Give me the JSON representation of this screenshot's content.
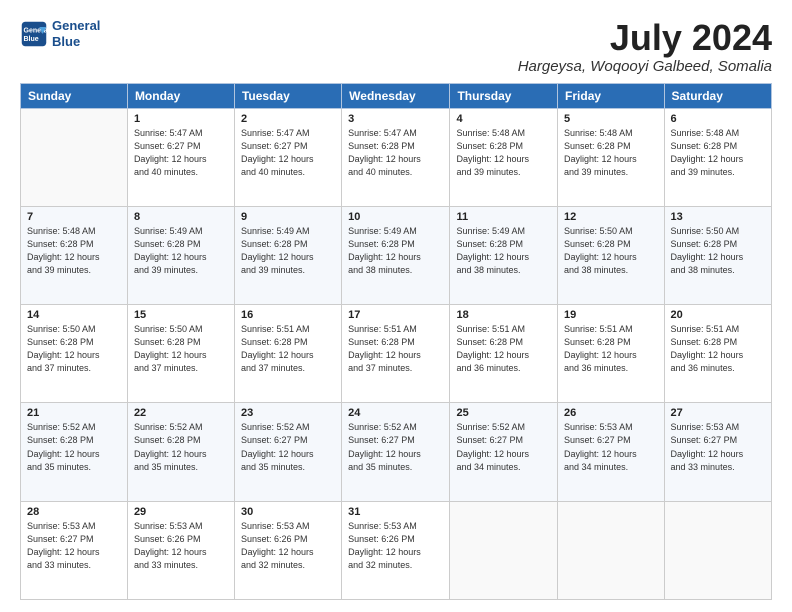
{
  "logo": {
    "line1": "General",
    "line2": "Blue"
  },
  "title": "July 2024",
  "subtitle": "Hargeysa, Woqooyi Galbeed, Somalia",
  "weekdays": [
    "Sunday",
    "Monday",
    "Tuesday",
    "Wednesday",
    "Thursday",
    "Friday",
    "Saturday"
  ],
  "weeks": [
    [
      {
        "day": "",
        "info": ""
      },
      {
        "day": "1",
        "info": "Sunrise: 5:47 AM\nSunset: 6:27 PM\nDaylight: 12 hours\nand 40 minutes."
      },
      {
        "day": "2",
        "info": "Sunrise: 5:47 AM\nSunset: 6:27 PM\nDaylight: 12 hours\nand 40 minutes."
      },
      {
        "day": "3",
        "info": "Sunrise: 5:47 AM\nSunset: 6:28 PM\nDaylight: 12 hours\nand 40 minutes."
      },
      {
        "day": "4",
        "info": "Sunrise: 5:48 AM\nSunset: 6:28 PM\nDaylight: 12 hours\nand 39 minutes."
      },
      {
        "day": "5",
        "info": "Sunrise: 5:48 AM\nSunset: 6:28 PM\nDaylight: 12 hours\nand 39 minutes."
      },
      {
        "day": "6",
        "info": "Sunrise: 5:48 AM\nSunset: 6:28 PM\nDaylight: 12 hours\nand 39 minutes."
      }
    ],
    [
      {
        "day": "7",
        "info": "Sunrise: 5:48 AM\nSunset: 6:28 PM\nDaylight: 12 hours\nand 39 minutes."
      },
      {
        "day": "8",
        "info": "Sunrise: 5:49 AM\nSunset: 6:28 PM\nDaylight: 12 hours\nand 39 minutes."
      },
      {
        "day": "9",
        "info": "Sunrise: 5:49 AM\nSunset: 6:28 PM\nDaylight: 12 hours\nand 39 minutes."
      },
      {
        "day": "10",
        "info": "Sunrise: 5:49 AM\nSunset: 6:28 PM\nDaylight: 12 hours\nand 38 minutes."
      },
      {
        "day": "11",
        "info": "Sunrise: 5:49 AM\nSunset: 6:28 PM\nDaylight: 12 hours\nand 38 minutes."
      },
      {
        "day": "12",
        "info": "Sunrise: 5:50 AM\nSunset: 6:28 PM\nDaylight: 12 hours\nand 38 minutes."
      },
      {
        "day": "13",
        "info": "Sunrise: 5:50 AM\nSunset: 6:28 PM\nDaylight: 12 hours\nand 38 minutes."
      }
    ],
    [
      {
        "day": "14",
        "info": "Sunrise: 5:50 AM\nSunset: 6:28 PM\nDaylight: 12 hours\nand 37 minutes."
      },
      {
        "day": "15",
        "info": "Sunrise: 5:50 AM\nSunset: 6:28 PM\nDaylight: 12 hours\nand 37 minutes."
      },
      {
        "day": "16",
        "info": "Sunrise: 5:51 AM\nSunset: 6:28 PM\nDaylight: 12 hours\nand 37 minutes."
      },
      {
        "day": "17",
        "info": "Sunrise: 5:51 AM\nSunset: 6:28 PM\nDaylight: 12 hours\nand 37 minutes."
      },
      {
        "day": "18",
        "info": "Sunrise: 5:51 AM\nSunset: 6:28 PM\nDaylight: 12 hours\nand 36 minutes."
      },
      {
        "day": "19",
        "info": "Sunrise: 5:51 AM\nSunset: 6:28 PM\nDaylight: 12 hours\nand 36 minutes."
      },
      {
        "day": "20",
        "info": "Sunrise: 5:51 AM\nSunset: 6:28 PM\nDaylight: 12 hours\nand 36 minutes."
      }
    ],
    [
      {
        "day": "21",
        "info": "Sunrise: 5:52 AM\nSunset: 6:28 PM\nDaylight: 12 hours\nand 35 minutes."
      },
      {
        "day": "22",
        "info": "Sunrise: 5:52 AM\nSunset: 6:28 PM\nDaylight: 12 hours\nand 35 minutes."
      },
      {
        "day": "23",
        "info": "Sunrise: 5:52 AM\nSunset: 6:27 PM\nDaylight: 12 hours\nand 35 minutes."
      },
      {
        "day": "24",
        "info": "Sunrise: 5:52 AM\nSunset: 6:27 PM\nDaylight: 12 hours\nand 35 minutes."
      },
      {
        "day": "25",
        "info": "Sunrise: 5:52 AM\nSunset: 6:27 PM\nDaylight: 12 hours\nand 34 minutes."
      },
      {
        "day": "26",
        "info": "Sunrise: 5:53 AM\nSunset: 6:27 PM\nDaylight: 12 hours\nand 34 minutes."
      },
      {
        "day": "27",
        "info": "Sunrise: 5:53 AM\nSunset: 6:27 PM\nDaylight: 12 hours\nand 33 minutes."
      }
    ],
    [
      {
        "day": "28",
        "info": "Sunrise: 5:53 AM\nSunset: 6:27 PM\nDaylight: 12 hours\nand 33 minutes."
      },
      {
        "day": "29",
        "info": "Sunrise: 5:53 AM\nSunset: 6:26 PM\nDaylight: 12 hours\nand 33 minutes."
      },
      {
        "day": "30",
        "info": "Sunrise: 5:53 AM\nSunset: 6:26 PM\nDaylight: 12 hours\nand 32 minutes."
      },
      {
        "day": "31",
        "info": "Sunrise: 5:53 AM\nSunset: 6:26 PM\nDaylight: 12 hours\nand 32 minutes."
      },
      {
        "day": "",
        "info": ""
      },
      {
        "day": "",
        "info": ""
      },
      {
        "day": "",
        "info": ""
      }
    ]
  ]
}
